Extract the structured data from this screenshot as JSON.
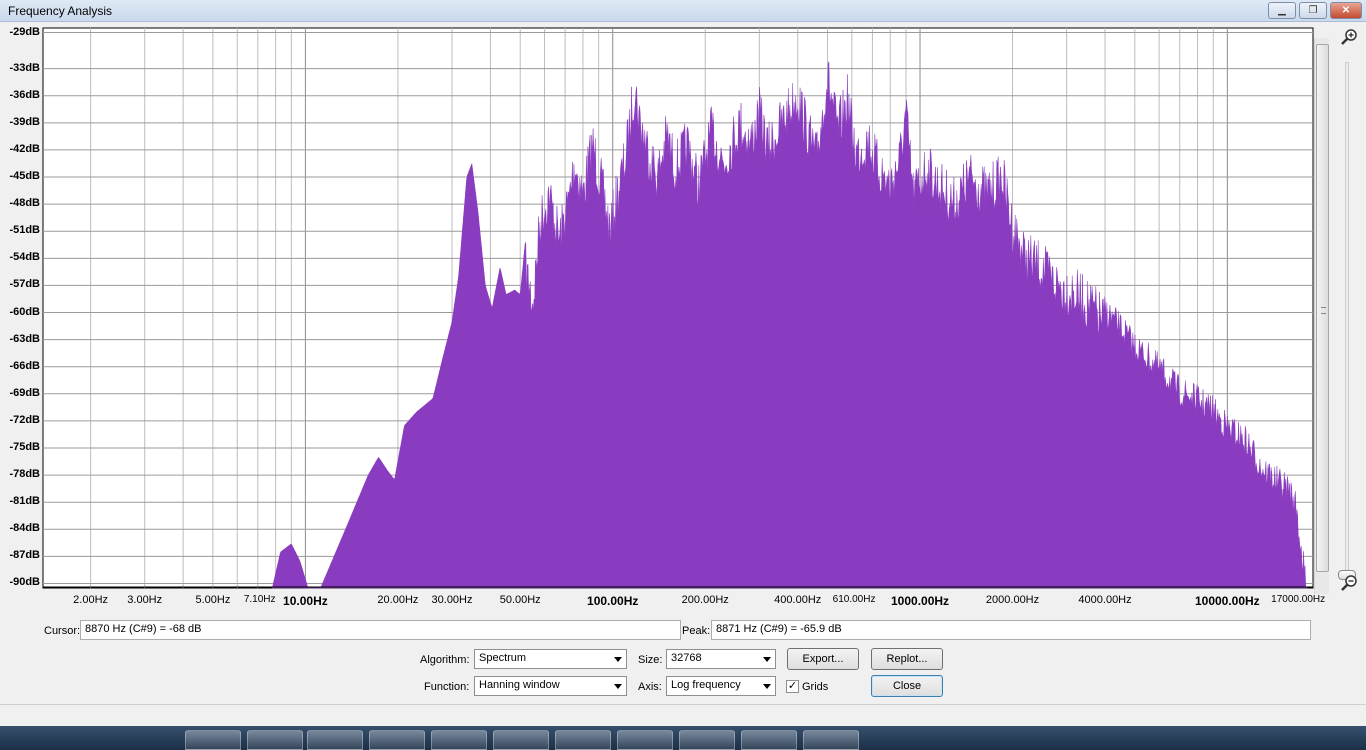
{
  "window": {
    "title": "Frequency Analysis",
    "controls": {
      "minimize": "▁",
      "restore": "❐",
      "close": "✕"
    }
  },
  "chart_data": {
    "type": "area",
    "x_scale": "log",
    "color": "#8a3cc0",
    "y_ticks": [
      "-29dB",
      "-33dB",
      "-36dB",
      "-39dB",
      "-42dB",
      "-45dB",
      "-48dB",
      "-51dB",
      "-54dB",
      "-57dB",
      "-60dB",
      "-63dB",
      "-66dB",
      "-69dB",
      "-72dB",
      "-75dB",
      "-78dB",
      "-81dB",
      "-84dB",
      "-87dB",
      "-90dB"
    ],
    "x_ticks": [
      {
        "label": "2.00Hz",
        "value": 2,
        "style": "normal"
      },
      {
        "label": "3.00Hz",
        "value": 3,
        "style": "normal"
      },
      {
        "label": "5.00Hz",
        "value": 5,
        "style": "normal"
      },
      {
        "label": "7.10Hz",
        "value": 7.1,
        "style": "small"
      },
      {
        "label": "10.00Hz",
        "value": 10,
        "style": "major"
      },
      {
        "label": "20.00Hz",
        "value": 20,
        "style": "normal"
      },
      {
        "label": "30.00Hz",
        "value": 30,
        "style": "normal"
      },
      {
        "label": "50.00Hz",
        "value": 50,
        "style": "normal"
      },
      {
        "label": "100.00Hz",
        "value": 100,
        "style": "major"
      },
      {
        "label": "200.00Hz",
        "value": 200,
        "style": "normal"
      },
      {
        "label": "400.00Hz",
        "value": 400,
        "style": "normal"
      },
      {
        "label": "610.00Hz",
        "value": 610,
        "style": "small"
      },
      {
        "label": "1000.00Hz",
        "value": 1000,
        "style": "major"
      },
      {
        "label": "2000.00Hz",
        "value": 2000,
        "style": "normal"
      },
      {
        "label": "4000.00Hz",
        "value": 4000,
        "style": "normal"
      },
      {
        "label": "10000.00Hz",
        "value": 10000,
        "style": "major"
      },
      {
        "label": "17000.00Hz",
        "value": 17000,
        "style": "small"
      }
    ],
    "x_range": [
      1.4,
      19000
    ],
    "y_range": [
      -90.5,
      -28.5
    ],
    "envelope": [
      [
        7.8,
        -90.5
      ],
      [
        8.3,
        -86.5
      ],
      [
        9.0,
        -85.6
      ],
      [
        9.6,
        -87.5
      ],
      [
        10.2,
        -90.5
      ],
      [
        11.2,
        -90.5
      ],
      [
        13.5,
        -84
      ],
      [
        16,
        -78
      ],
      [
        17.3,
        -76
      ],
      [
        18.5,
        -77.5
      ],
      [
        19.5,
        -78.5
      ],
      [
        21,
        -72.5
      ],
      [
        23,
        -71
      ],
      [
        26,
        -69.5
      ],
      [
        28,
        -65
      ],
      [
        30,
        -61
      ],
      [
        31.5,
        -56
      ],
      [
        33.5,
        -45
      ],
      [
        34.8,
        -43.5
      ],
      [
        36.5,
        -49
      ],
      [
        38.5,
        -57
      ],
      [
        40.5,
        -59.5
      ],
      [
        43,
        -55
      ],
      [
        45,
        -58
      ],
      [
        48,
        -57.5
      ],
      [
        50,
        -58
      ],
      [
        52,
        -52
      ],
      [
        55,
        -56
      ],
      [
        58,
        -47
      ],
      [
        62,
        -44
      ],
      [
        67,
        -49
      ],
      [
        72,
        -44.5
      ],
      [
        75,
        -40.5
      ],
      [
        80,
        -44
      ],
      [
        86,
        -38.5
      ],
      [
        92,
        -43
      ],
      [
        98,
        -48
      ],
      [
        105,
        -43
      ],
      [
        110,
        -40
      ],
      [
        118,
        -32
      ],
      [
        122,
        -35.5
      ],
      [
        130,
        -39
      ],
      [
        140,
        -42
      ],
      [
        150,
        -37.5
      ],
      [
        160,
        -41
      ],
      [
        175,
        -38.5
      ],
      [
        190,
        -43
      ],
      [
        210,
        -37
      ],
      [
        230,
        -40.5
      ],
      [
        260,
        -36
      ],
      [
        280,
        -38.5
      ],
      [
        300,
        -35
      ],
      [
        320,
        -39
      ],
      [
        350,
        -36.5
      ],
      [
        400,
        -33
      ],
      [
        430,
        -37
      ],
      [
        460,
        -40
      ],
      [
        500,
        -31
      ],
      [
        540,
        -37
      ],
      [
        580,
        -33.5
      ],
      [
        620,
        -39.5
      ],
      [
        680,
        -38
      ],
      [
        730,
        -41
      ],
      [
        800,
        -43
      ],
      [
        860,
        -40
      ],
      [
        900,
        -35
      ],
      [
        950,
        -44
      ],
      [
        1050,
        -41
      ],
      [
        1150,
        -43
      ],
      [
        1300,
        -45
      ],
      [
        1450,
        -42
      ],
      [
        1650,
        -44
      ],
      [
        1850,
        -42
      ],
      [
        2000,
        -47.5
      ],
      [
        2200,
        -51
      ],
      [
        2450,
        -52
      ],
      [
        2800,
        -54
      ],
      [
        3200,
        -55
      ],
      [
        3600,
        -56.5
      ],
      [
        4000,
        -58
      ],
      [
        4500,
        -60
      ],
      [
        5000,
        -62
      ],
      [
        5600,
        -63.5
      ],
      [
        6200,
        -65
      ],
      [
        7000,
        -67
      ],
      [
        8000,
        -68
      ],
      [
        8900,
        -69
      ],
      [
        10000,
        -71
      ],
      [
        11500,
        -72.5
      ],
      [
        13000,
        -75.5
      ],
      [
        14500,
        -77
      ],
      [
        16000,
        -78
      ],
      [
        16800,
        -80
      ],
      [
        17300,
        -84
      ],
      [
        17800,
        -87
      ],
      [
        18200,
        -90.5
      ]
    ]
  },
  "cursor": {
    "label": "Cursor:",
    "value": "8870 Hz (C#9) = -68 dB"
  },
  "peak": {
    "label": "Peak:",
    "value": "8871 Hz (C#9) = -65.9 dB"
  },
  "controls": {
    "algorithm": {
      "label": "Algorithm:",
      "value": "Spectrum"
    },
    "size": {
      "label": "Size:",
      "value": "32768"
    },
    "function": {
      "label": "Function:",
      "value": "Hanning window"
    },
    "axis": {
      "label": "Axis:",
      "value": "Log frequency"
    },
    "grids": {
      "label": "Grids",
      "checked": true
    },
    "export_label": "Export...",
    "replot_label": "Replot...",
    "close_label": "Close"
  },
  "icons": {
    "zoom_in": "zoom-in-icon",
    "zoom_out": "zoom-out-icon"
  }
}
